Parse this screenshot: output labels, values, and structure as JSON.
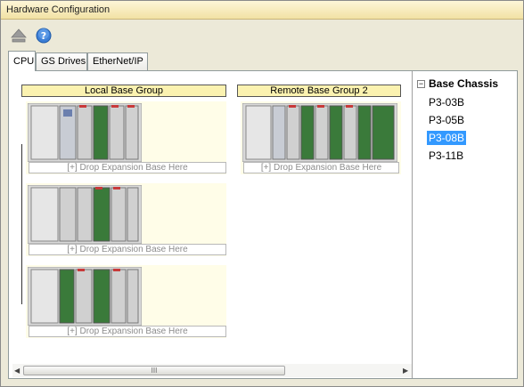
{
  "window": {
    "title": "Hardware Configuration"
  },
  "toolbar": {
    "upload_icon": "eject-icon",
    "help_icon": "help-icon"
  },
  "tabs": [
    {
      "label": "CPU",
      "active": true
    },
    {
      "label": "GS Drives",
      "active": false
    },
    {
      "label": "EtherNet/IP",
      "active": false
    }
  ],
  "groups": {
    "local": {
      "label": "Local Base Group",
      "drop_text": "[+] Drop Expansion Base Here"
    },
    "remote": {
      "label": "Remote Base Group 2",
      "drop_text": "[+] Drop Expansion Base Here"
    }
  },
  "tree": {
    "header": "Base Chassis",
    "items": [
      {
        "label": "P3-03B",
        "selected": false
      },
      {
        "label": "P3-05B",
        "selected": false
      },
      {
        "label": "P3-08B",
        "selected": true
      },
      {
        "label": "P3-11B",
        "selected": false
      }
    ]
  },
  "scrollbar": {
    "grip": "III"
  },
  "colors": {
    "header_bg": "#fbf2b0",
    "base_bg": "#fffde8",
    "selected": "#3399ff"
  }
}
